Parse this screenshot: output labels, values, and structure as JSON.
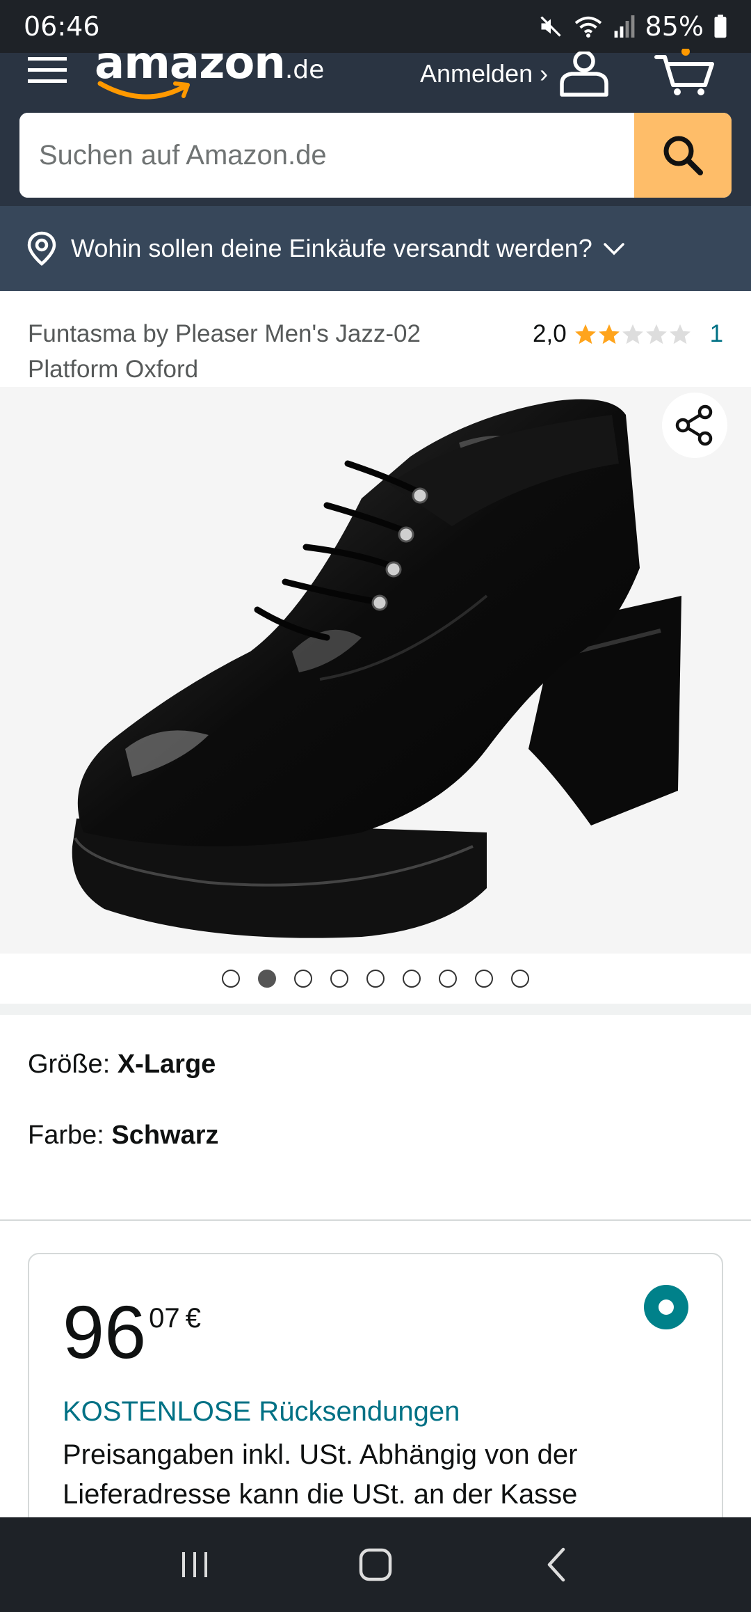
{
  "status_bar": {
    "time": "06:46",
    "battery": "85%",
    "icons": [
      "mute-icon",
      "wifi-icon",
      "signal-icon",
      "battery-icon"
    ]
  },
  "header": {
    "logo_text": "amazon",
    "logo_tld": ".de",
    "signin_label": "Anmelden ›",
    "search_placeholder": "Suchen auf Amazon.de",
    "deliver_text": "Wohin sollen deine Einkäufe versandt werden?",
    "colors": {
      "header_bg": "#2a3442",
      "deliver_bg": "#37475a",
      "search_button": "#febd69"
    }
  },
  "product": {
    "title": "Funtasma by Pleaser Men's Jazz-02 Platform Oxford",
    "rating_value": "2,0",
    "rating_stars": 2,
    "rating_max": 5,
    "rating_count": "1",
    "image_count": 9,
    "active_image_index": 1
  },
  "variations": {
    "size_label": "Größe: ",
    "size_value": "X-Large",
    "color_label": "Farbe: ",
    "color_value": "Schwarz"
  },
  "buybox": {
    "price_whole": "96",
    "price_fraction": "07",
    "currency": "€",
    "returns": "KOSTENLOSE Rücksendungen",
    "tax_note": "Preisangaben inkl. USt. Abhängig von der Lieferadresse kann die USt. an der Kasse",
    "accent_color": "#007185"
  },
  "nav_bar": {
    "buttons": [
      "recents-icon",
      "home-icon",
      "back-icon"
    ]
  }
}
